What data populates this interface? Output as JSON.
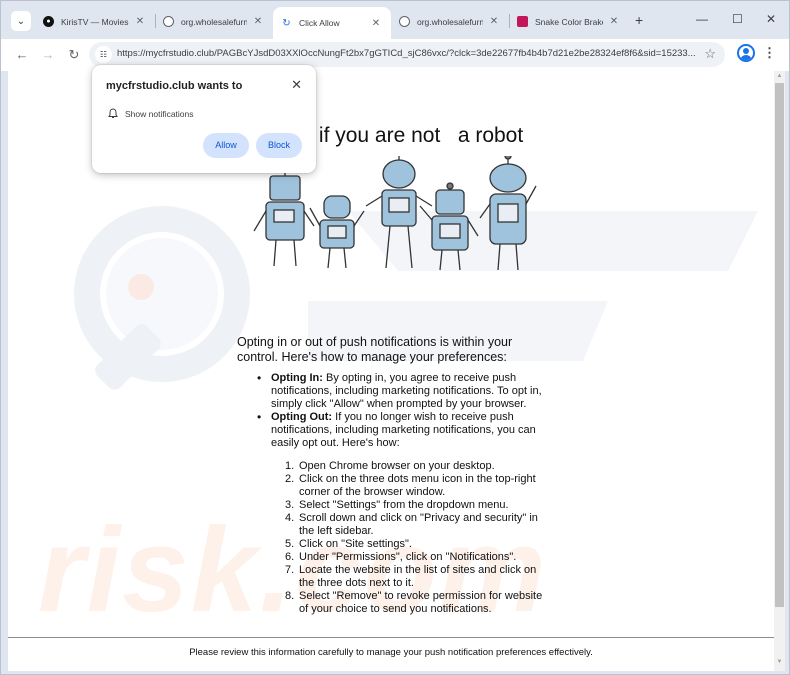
{
  "tabs": [
    {
      "title": "KirisTV — Movies a",
      "active": false
    },
    {
      "title": "org.wholesalefurnit",
      "active": false
    },
    {
      "title": "Click Allow",
      "active": true
    },
    {
      "title": "org.wholesalefurnit",
      "active": false
    },
    {
      "title": "Snake Color Brake",
      "active": false
    }
  ],
  "toolbar": {
    "url": "https://mycfrstudio.club/PAGBcYJsdD03XXlOccNungFt2bx7gGTICd_sjC86vxc/?clck=3de22677fb4b4b7d21e2be28324ef8f6&sid=15233..."
  },
  "popup": {
    "title": "mycfrstudio.club wants to",
    "permission": "Show notifications",
    "allow_label": "Allow",
    "block_label": "Block"
  },
  "page": {
    "headline": "w\"   if you are not   a robot",
    "intro": "Opting in or out of push notifications is within your control. Here's how to manage your preferences:",
    "bullets": [
      {
        "bold": "Opting In:",
        "text": " By opting in, you agree to receive push notifications, including marketing notifications. To opt in, simply click \"Allow\" when prompted by your browser."
      },
      {
        "bold": "Opting Out:",
        "text": " If you no longer wish to receive push notifications, including marketing notifications, you can easily opt out. Here's how:"
      }
    ],
    "steps": [
      {
        "num": "1.",
        "text": "Open Chrome browser on your desktop."
      },
      {
        "num": "2.",
        "text": "Click on the three dots menu icon in the top-right corner of the browser window."
      },
      {
        "num": "3.",
        "text": "Select \"Settings\" from the dropdown menu."
      },
      {
        "num": "4.",
        "text": "Scroll down and click on \"Privacy and security\" in the left sidebar."
      },
      {
        "num": "5.",
        "text": "Click on \"Site settings\"."
      },
      {
        "num": "6.",
        "text": "Under \"Permissions\", click on \"Notifications\"."
      },
      {
        "num": "7.",
        "text": "Locate the website in the list of sites and click on the three dots next to it."
      },
      {
        "num": "8.",
        "text": "Select \"Remove\" to revoke permission for website of your choice to send you notifications."
      }
    ],
    "footer": "Please review this information carefully to manage your push notification preferences effectively.",
    "watermark": "risk.com"
  }
}
